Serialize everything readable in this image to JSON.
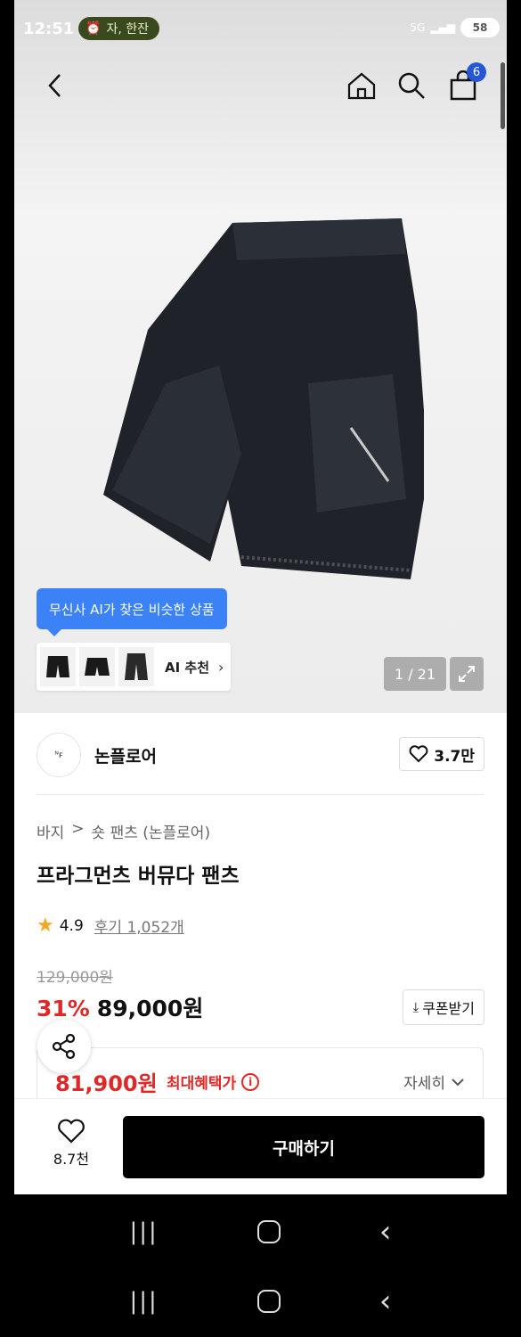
{
  "status_bar": {
    "time": "12:51",
    "pill_text": "자, 한잔",
    "battery": "58",
    "network": "5G"
  },
  "nav": {
    "cart_count": "6"
  },
  "gallery": {
    "ai_tooltip": "무신사 AI가 찾은 비슷한 상품",
    "ai_recommend_label": "AI 추천",
    "page_counter": "1 / 21"
  },
  "brand": {
    "name": "논플로어",
    "logo_text": "ᴺꜰ",
    "likes": "3.7만"
  },
  "product": {
    "breadcrumb": [
      "바지",
      ">",
      "숏 팬츠 (논플로어)"
    ],
    "title": "프라그먼츠 버뮤다 팬츠",
    "rating": "4.9",
    "reviews": "후기 1,052개",
    "original_price": "129,000원",
    "discount": "31%",
    "price": "89,000원",
    "coupon_label": "쿠폰받기",
    "max_benefit_price": "81,900원",
    "max_benefit_label": "최대혜택가",
    "detail_label": "자세히"
  },
  "bottom_bar": {
    "wish_count": "8.7천",
    "buy_label": "구매하기"
  },
  "colors": {
    "accent_blue": "#3b82f6",
    "sale_red": "#e02828",
    "buy_black": "#000000"
  }
}
